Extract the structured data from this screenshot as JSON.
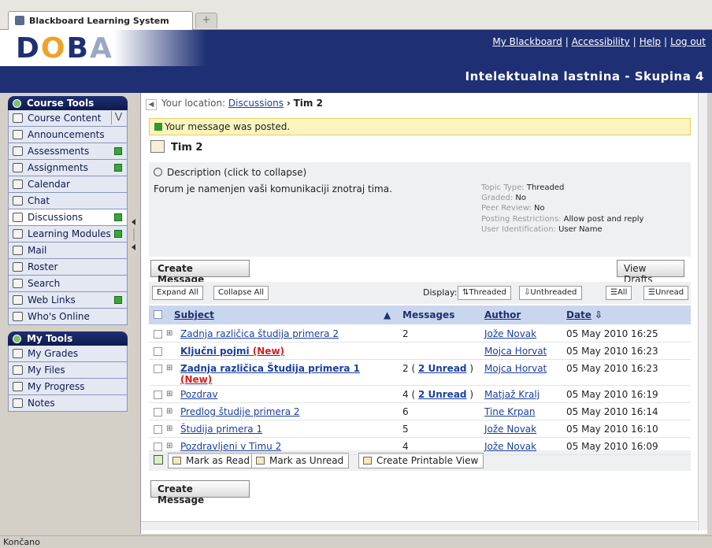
{
  "browser": {
    "tab_title": "Blackboard Learning System",
    "new_tab": "+"
  },
  "header": {
    "logo": [
      "D",
      "O",
      "B",
      "A"
    ],
    "links": [
      "My Blackboard",
      "Accessibility",
      "Help",
      "Log out"
    ],
    "course_title": "Intelektualna lastnina - Skupina 4"
  },
  "sidebar": {
    "course_tools_title": "Course Tools",
    "course_items": [
      {
        "label": "Course Content"
      },
      {
        "label": "Announcements"
      },
      {
        "label": "Assessments"
      },
      {
        "label": "Assignments"
      },
      {
        "label": "Calendar"
      },
      {
        "label": "Chat"
      },
      {
        "label": "Discussions"
      },
      {
        "label": "Learning Modules"
      },
      {
        "label": "Mail"
      },
      {
        "label": "Roster"
      },
      {
        "label": "Search"
      },
      {
        "label": "Web Links"
      },
      {
        "label": "Who's Online"
      }
    ],
    "my_tools_title": "My Tools",
    "my_items": [
      {
        "label": "My Grades"
      },
      {
        "label": "My Files"
      },
      {
        "label": "My Progress"
      },
      {
        "label": "Notes"
      }
    ]
  },
  "breadcrumb": {
    "prefix": "Your location:",
    "link": "Discussions",
    "sep": "›",
    "current": "Tim 2"
  },
  "receipt": "Your message was posted.",
  "forum_title": "Tim 2",
  "description": {
    "toggle": "Description (click to collapse)",
    "text": "Forum je namenjen vaši komunikaciji znotraj tima.",
    "settings": [
      {
        "label": "Topic Type:",
        "value": "Threaded"
      },
      {
        "label": "Graded:",
        "value": "No"
      },
      {
        "label": "Peer Review:",
        "value": "No"
      },
      {
        "label": "Posting Restrictions:",
        "value": "Allow post and reply"
      },
      {
        "label": "User Identification:",
        "value": "User Name"
      }
    ]
  },
  "buttons": {
    "create_message": "Create Message",
    "view_drafts": "View Drafts"
  },
  "toolbar": {
    "expand_all": "Expand All",
    "collapse_all": "Collapse All",
    "display_label": "Display:",
    "threaded": "Threaded",
    "unthreaded": "Unthreaded",
    "all": "All",
    "unread": "Unread"
  },
  "table": {
    "headers": {
      "subject": "Subject",
      "messages": "Messages",
      "author": "Author",
      "date": "Date"
    },
    "rows": [
      {
        "subject": "Zadnja različica študija primera 2",
        "new": "",
        "messages": "2",
        "unread": "",
        "author": "Jože Novak",
        "date": "05 May 2010 16:25"
      },
      {
        "subject": "Ključni pojmi",
        "new": "(New)",
        "messages": "",
        "unread": "",
        "author": "Mojca Horvat",
        "date": "05 May 2010 16:23"
      },
      {
        "subject": "Zadnja različica Študija primera 1",
        "new": "(New)",
        "messages": "2",
        "unread": "2 Unread",
        "author": "Mojca Horvat",
        "date": "05 May 2010 16:23"
      },
      {
        "subject": "Pozdrav",
        "new": "",
        "messages": "4",
        "unread": "2 Unread",
        "author": "Matjaž Kralj",
        "date": "05 May 2010 16:19"
      },
      {
        "subject": "Predlog študije primera 2",
        "new": "",
        "messages": "6",
        "unread": "",
        "author": "Tine Krpan",
        "date": "05 May 2010 16:14"
      },
      {
        "subject": "Študija primera 1",
        "new": "",
        "messages": "5",
        "unread": "",
        "author": "Jože Novak",
        "date": "05 May 2010 16:10"
      },
      {
        "subject": "Pozdravljeni v Timu 2",
        "new": "",
        "messages": "4",
        "unread": "",
        "author": "Jože Novak",
        "date": "05 May 2010 16:09"
      }
    ]
  },
  "actions": {
    "mark_read": "Mark as Read",
    "mark_unread": "Mark as Unread",
    "printable": "Create Printable View"
  },
  "status_bar": "Končano"
}
